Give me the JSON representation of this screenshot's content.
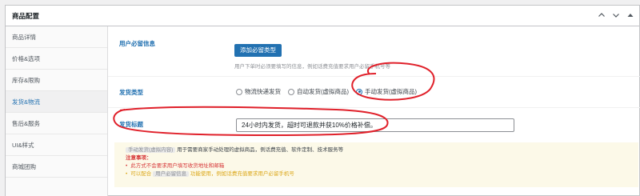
{
  "panel": {
    "title": "商品配置"
  },
  "sidebar": {
    "items": [
      {
        "label": "商品详情"
      },
      {
        "label": "价格&选项"
      },
      {
        "label": "库存&限购"
      },
      {
        "label": "发货&物流"
      },
      {
        "label": "售后&服务"
      },
      {
        "label": "UI&样式"
      },
      {
        "label": "商城团购"
      }
    ],
    "active_index": 3
  },
  "user_info": {
    "label": "用户必留信息",
    "button": "添加必留类型",
    "hint": "用户下单时必须要填写的信息，例如话费充值要求用户必留手机号等"
  },
  "delivery_type": {
    "label": "发货类型",
    "options": [
      {
        "label": "物流快递发货",
        "checked": false
      },
      {
        "label": "自动发货(虚拟商品)",
        "checked": false
      },
      {
        "label": "手动发货(虚拟商品)",
        "checked": true
      }
    ]
  },
  "delivery_title": {
    "label": "发货标题",
    "value": "24小时内发货，超时可退款并获10%价格补偿。"
  },
  "notice": {
    "tag1": "手动发货(虚拟内容)",
    "line1": "用于需要商家手动处理的虚拟商品，例话费充值、软件定制、技术服务等",
    "title": "注意事项：",
    "item1": "此方式不会要求用户填写收货地址和邮箱",
    "item2_pre": "可以配合",
    "item2_tag": "用户必留信息",
    "item2_post": "功能使用，例如话费充值要求用户必留手机号"
  },
  "colors": {
    "accent": "#2271b1",
    "annotation": "#e0202a",
    "notice_bg": "#fcf9e8"
  }
}
